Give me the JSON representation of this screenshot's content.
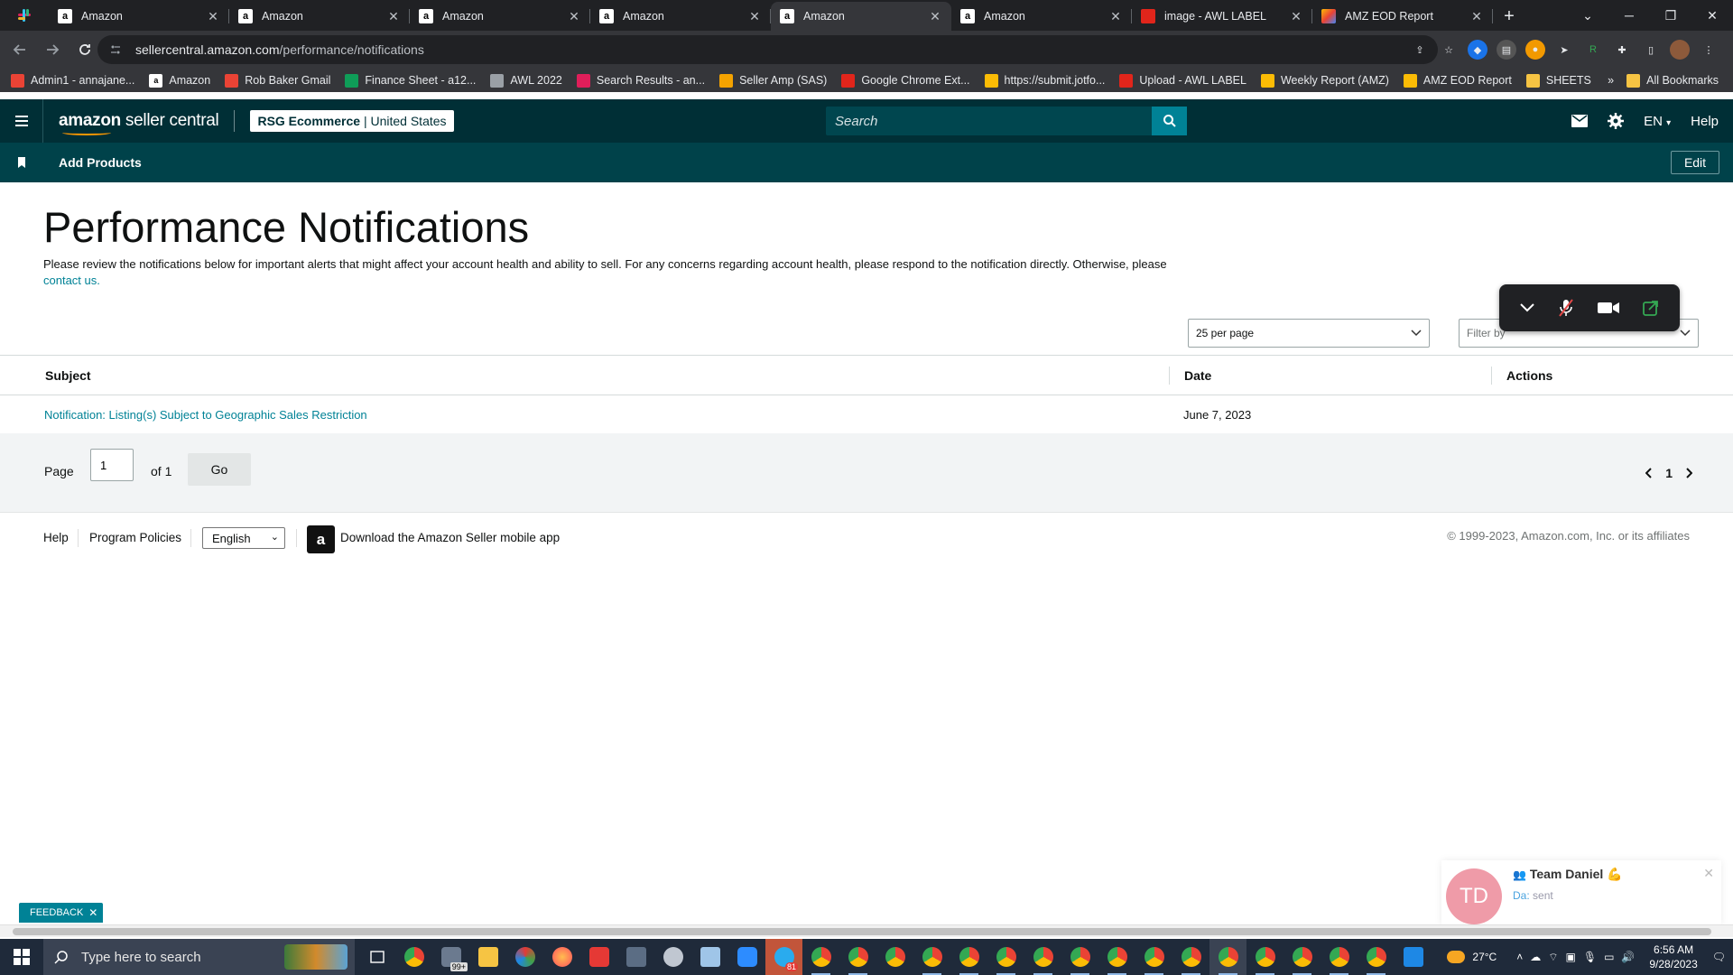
{
  "browser": {
    "tabs": [
      {
        "title": "Amazon",
        "favicon": "amazon-favicon",
        "active": false
      },
      {
        "title": "Amazon",
        "favicon": "amazon-favicon",
        "active": false
      },
      {
        "title": "Amazon",
        "favicon": "amazon-favicon",
        "active": false
      },
      {
        "title": "Amazon",
        "favicon": "amazon-favicon",
        "active": false
      },
      {
        "title": "Amazon",
        "favicon": "amazon-favicon",
        "active": true
      },
      {
        "title": "Amazon",
        "favicon": "amazon-favicon",
        "active": false
      },
      {
        "title": "image - AWL LABEL",
        "favicon": "awl-favicon",
        "active": false
      },
      {
        "title": "AMZ EOD Report",
        "favicon": "eod-favicon",
        "active": false
      }
    ],
    "url_host": "sellercentral.amazon.com",
    "url_path": "/performance/notifications",
    "bookmarks": [
      {
        "label": "Admin1 - annajane...",
        "icon": "gmail-icon",
        "color": "#ea4335"
      },
      {
        "label": "Amazon",
        "icon": "amazon-icon",
        "color": "#ffffff"
      },
      {
        "label": "Rob Baker Gmail",
        "icon": "gmail-icon",
        "color": "#ea4335"
      },
      {
        "label": "Finance Sheet - a12...",
        "icon": "sheets-plus-icon",
        "color": "#0f9d58"
      },
      {
        "label": "AWL 2022",
        "icon": "globe-icon",
        "color": "#9aa0a6"
      },
      {
        "label": "Search Results - an...",
        "icon": "slack-icon",
        "color": "#e01e5a"
      },
      {
        "label": "Seller Amp (SAS)",
        "icon": "selleramp-icon",
        "color": "#f4a300"
      },
      {
        "label": "Google Chrome Ext...",
        "icon": "check-icon",
        "color": "#e1251b"
      },
      {
        "label": "https://submit.jotfo...",
        "icon": "jotform-icon",
        "color": "#fbbc05"
      },
      {
        "label": "Upload - AWL LABEL",
        "icon": "awl-icon",
        "color": "#e1251b"
      },
      {
        "label": "Weekly Report (AMZ)",
        "icon": "report-icon",
        "color": "#fbbc05"
      },
      {
        "label": "AMZ EOD Report",
        "icon": "report-icon",
        "color": "#fbbc05"
      },
      {
        "label": "SHEETS",
        "icon": "folder-icon",
        "color": "#f6c443"
      }
    ],
    "all_bookmarks": "All Bookmarks"
  },
  "header": {
    "logo_bold": "amazon",
    "logo_light": " seller central",
    "store_name": "RSG Ecommerce",
    "store_sep": " | ",
    "store_region": "United States",
    "search_placeholder": "Search",
    "language": "EN",
    "help": "Help"
  },
  "subnav": {
    "add_products": "Add Products",
    "edit": "Edit"
  },
  "page": {
    "title": "Performance Notifications",
    "description": "Please review the notifications below for important alerts that might affect your account health and ability to sell. For any concerns regarding account health, please respond to the notification directly. Otherwise, please ",
    "contact_link": "contact us.",
    "per_page": "25 per page",
    "filter_placeholder": "Filter by"
  },
  "table": {
    "columns": [
      "Subject",
      "Date",
      "Actions"
    ],
    "rows": [
      {
        "subject": "Notification: Listing(s) Subject to Geographic Sales Restriction",
        "date": "June 7, 2023",
        "actions": ""
      }
    ]
  },
  "pager": {
    "page_label": "Page",
    "page_value": "1",
    "of_label": "of 1",
    "go": "Go",
    "current": "1"
  },
  "footer": {
    "help": "Help",
    "program_policies": "Program Policies",
    "language": "English",
    "download_app": "Download the Amazon Seller mobile app",
    "copyright": "© 1999-2023, Amazon.com, Inc. or its affiliates"
  },
  "toast": {
    "initials": "TD",
    "name": "Team Daniel 💪",
    "sub_prefix": "Da:",
    "sub_text": " sent"
  },
  "feedback": "FEEDBACK",
  "taskbar": {
    "search_placeholder": "Type here to search",
    "weather": "27°C",
    "time": "6:56 AM",
    "date": "9/28/2023",
    "mail_badge": "99+",
    "telegram_badge": "81"
  }
}
